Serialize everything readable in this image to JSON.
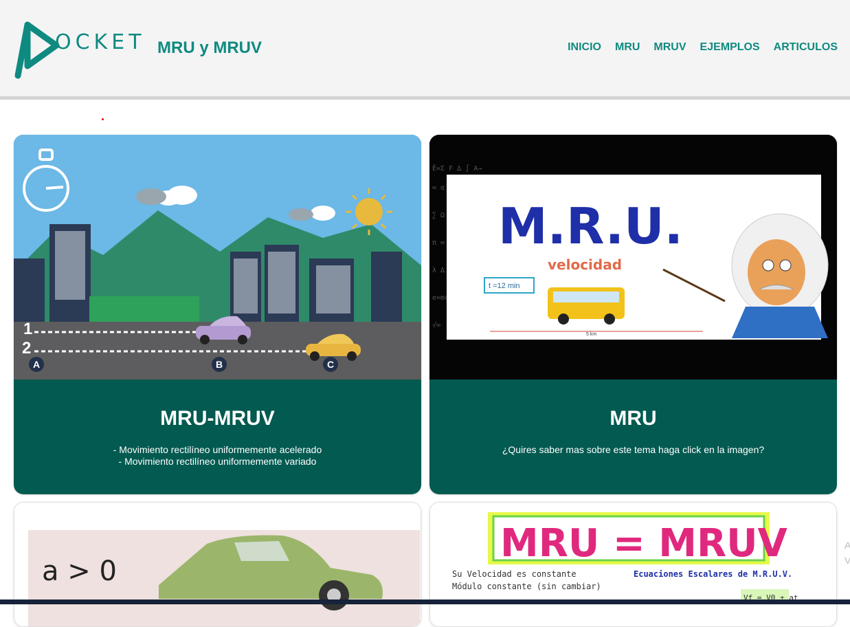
{
  "header": {
    "logo_text": "OCKET",
    "site_title": "MRU y MRUV",
    "nav": [
      "INICIO",
      "MRU",
      "MRUV",
      "EJEMPLOS",
      "ARTICULOS"
    ]
  },
  "cards": [
    {
      "title": "MRU-MRUV",
      "desc_lines": [
        "- Movimiento rectilíneo uniformemente acelerado",
        "- Movimiento rectilíneo uniformemente variado"
      ],
      "image_labels": {
        "lane1": "1",
        "lane2": "2",
        "a": "A",
        "b": "B",
        "c": "C"
      }
    },
    {
      "title": "MRU",
      "desc_lines": [
        "¿Quires saber mas sobre este tema haga click en la imagen?"
      ],
      "image_labels": {
        "heading": "M.R.U.",
        "subtitle": "velocidad",
        "time": "t =12 min",
        "distance": "5 km"
      }
    },
    {
      "image_labels": {
        "formula": "a > 0"
      }
    },
    {
      "image_labels": {
        "heading": "MRU = MRUV",
        "line1": "Su Velocidad es constante",
        "line2": "Módulo constante (sin cambiar)",
        "line3": "Ecuaciones Escalares de M.R.U.V.",
        "formula": "Vf = V0 ± at"
      }
    }
  ],
  "side_text": [
    "A",
    "V"
  ],
  "colors": {
    "accent": "#0f8a80",
    "card_bg": "#035a50"
  }
}
